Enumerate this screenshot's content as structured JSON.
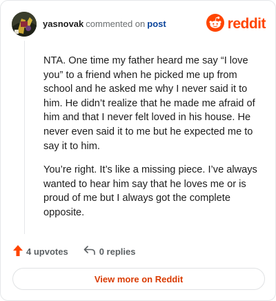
{
  "header": {
    "username": "yasnovak",
    "action_text": "commented on",
    "post_link": "post",
    "brand": "reddit"
  },
  "comment": {
    "paragraphs": [
      "NTA. One time my father heard me say “I love you” to a friend when he picked me up from school and he asked me why I never said it to him. He didn’t realize that he made me afraid of him and that I never felt loved in his house. He never even said it to me but he expected me to say it to him.",
      "You’re right. It’s like a missing piece. I’ve always wanted to hear him say that he loves me or is proud of me but I always got the complete opposite."
    ]
  },
  "actions": {
    "upvotes": "4 upvotes",
    "replies": "0 replies"
  },
  "view_more_label": "View more on Reddit",
  "colors": {
    "brand": "#ff4500",
    "link": "#0a449b",
    "cta": "#d93a00"
  },
  "icons": {
    "brand": "reddit-snoo-icon",
    "upvote": "upvote-arrow-icon",
    "reply": "reply-arrow-icon"
  }
}
